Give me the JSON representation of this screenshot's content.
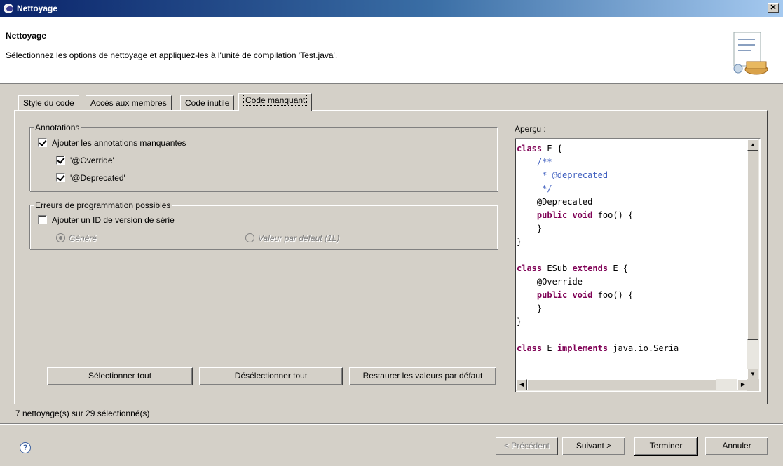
{
  "window": {
    "title": "Nettoyage",
    "close_icon": "close-icon"
  },
  "header": {
    "title": "Nettoyage",
    "description": "Sélectionnez les options de nettoyage et appliquez-les à l'unité de compilation 'Test.java'."
  },
  "tabs": [
    {
      "label": "Style du code"
    },
    {
      "label": "Accès aux membres"
    },
    {
      "label": "Code inutile"
    },
    {
      "label": "Code manquant",
      "active": true
    }
  ],
  "annotations": {
    "group_label": "Annotations",
    "add_missing": {
      "label": "Ajouter les annotations manquantes",
      "checked": true
    },
    "override": {
      "label": "'@Override'",
      "checked": true
    },
    "deprecated": {
      "label": "'@Deprecated'",
      "checked": true
    }
  },
  "errors": {
    "group_label": "Erreurs de programmation possibles",
    "add_serial": {
      "label": "Ajouter un ID de version de série",
      "checked": false
    },
    "generated": {
      "label": "Généré",
      "selected": true
    },
    "default_value": {
      "label": "Valeur par défaut (1L)",
      "selected": false
    }
  },
  "buttons": {
    "select_all": "Sélectionner tout",
    "deselect_all": "Désélectionner tout",
    "restore_defaults": "Restaurer les valeurs par défaut"
  },
  "preview": {
    "label": "Aperçu :",
    "code_lines": [
      "class E {",
      "    /**",
      "     * @deprecated",
      "     */",
      "    @Deprecated",
      "    public void foo() {",
      "    }",
      "}",
      "",
      "class ESub extends E {",
      "    @Override",
      "    public void foo() {",
      "    }",
      "}",
      "",
      "class E implements java.io.Seria"
    ]
  },
  "status": "7 nettoyage(s) sur 29 sélectionné(s)",
  "footer": {
    "back": "< Précédent",
    "next": "Suivant >",
    "finish": "Terminer",
    "cancel": "Annuler"
  },
  "colors": {
    "title_bar": "#0a246a",
    "keyword": "#7f0055",
    "javadoc": "#3f5fbf",
    "face": "#d4d0c8"
  }
}
